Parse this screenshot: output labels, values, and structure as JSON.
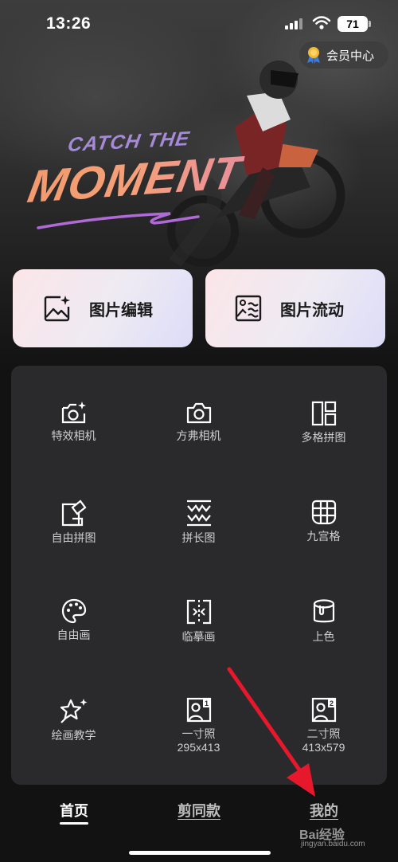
{
  "status": {
    "time": "13:26",
    "battery": "71"
  },
  "header": {
    "vip_label": "会员中心"
  },
  "hero": {
    "line1": "CATCH THE",
    "line2": "MOMENT"
  },
  "cards": [
    {
      "label": "图片编辑",
      "icon": "photo-sparkle-icon"
    },
    {
      "label": "图片流动",
      "icon": "photo-wave-icon"
    }
  ],
  "tools": [
    {
      "label": "特效相机",
      "icon": "effect-camera-icon"
    },
    {
      "label": "方弗相机",
      "icon": "camera-icon"
    },
    {
      "label": "多格拼图",
      "icon": "grid-collage-icon"
    },
    {
      "label": "自由拼图",
      "icon": "free-collage-icon"
    },
    {
      "label": "拼长图",
      "icon": "long-image-icon"
    },
    {
      "label": "九宫格",
      "icon": "nine-grid-icon"
    },
    {
      "label": "自由画",
      "icon": "palette-icon"
    },
    {
      "label": "临摹画",
      "icon": "trace-icon"
    },
    {
      "label": "上色",
      "icon": "paint-bucket-icon"
    },
    {
      "label": "绘画教学",
      "icon": "star-sparkle-icon"
    },
    {
      "label": "一寸照",
      "sub": "295x413",
      "icon": "id-photo-1-icon"
    },
    {
      "label": "二寸照",
      "sub": "413x579",
      "icon": "id-photo-2-icon"
    }
  ],
  "tabs": [
    {
      "label": "首页",
      "active": true
    },
    {
      "label": "剪同款",
      "active": false
    },
    {
      "label": "我的",
      "active": false
    }
  ],
  "watermark": {
    "brand": "Bai经验",
    "url": "jingyan.baidu.com"
  },
  "colors": {
    "accent_arrow": "#e8182c",
    "card_gradient_start": "#fbe6e8",
    "card_gradient_end": "#dcdcf8",
    "panel": "#2a2a2c"
  }
}
